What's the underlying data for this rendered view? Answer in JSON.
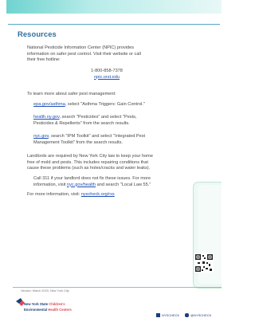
{
  "heading": "Resources",
  "npic": {
    "line1": "National Pesticide Information Center (NPIC) provides",
    "line2": "information on safer pest control. Visit their website or call",
    "line3": "their free hotline:",
    "phone": "1-800-858-7378",
    "url": "npic.orst.edu"
  },
  "learn_intro": "To learn more about safer pest management:",
  "resources": [
    {
      "link": "epa.gov/asthma",
      "rest1": ", select \"Asthma Triggers: Gain Control.\"",
      "rest2": ""
    },
    {
      "link": "health.ny.gov",
      "rest1": ", search \"Pesticides\" and select \"Pests,",
      "rest2": "Pesticides & Repellents\" from the search results."
    },
    {
      "link": "nyc.gov",
      "rest1": ", search \"IPM Toolkit\" and select \"Integrated Pest",
      "rest2": "Management Toolkit\" from the search results."
    }
  ],
  "landlords": {
    "line1": "Landlords are required by New York City law to keep your home",
    "line2": "free of mold and pests. This includes repairing conditions that",
    "line3": "cause these problems (such as holes/cracks and water leaks)."
  },
  "call311": {
    "line1": "Call 311 if your landlord does not fix these issues. For more",
    "line2_pre": "information, visit ",
    "line2_link": "nyc.gov/health",
    "line2_post": " and search \"Local Law 55.\""
  },
  "more_info": {
    "pre": "For more information, visit: ",
    "link": "nyscheck.org/rxs"
  },
  "version": "Version: March 2020, New York City",
  "logo": {
    "line1_pre": "New York State ",
    "line1_accent": "Children's",
    "line2_pre": "Environmental ",
    "line2_accent": "Health Centers"
  },
  "social": {
    "facebook": "NYSCHECK",
    "twitter": "@NYSCHECK"
  },
  "colors": {
    "heading": "#2f6f9d",
    "link": "#1f4fb8",
    "stripe": "#6fd3cf",
    "logo_text": "#1d3f7a",
    "logo_accent": "#e0484f"
  }
}
